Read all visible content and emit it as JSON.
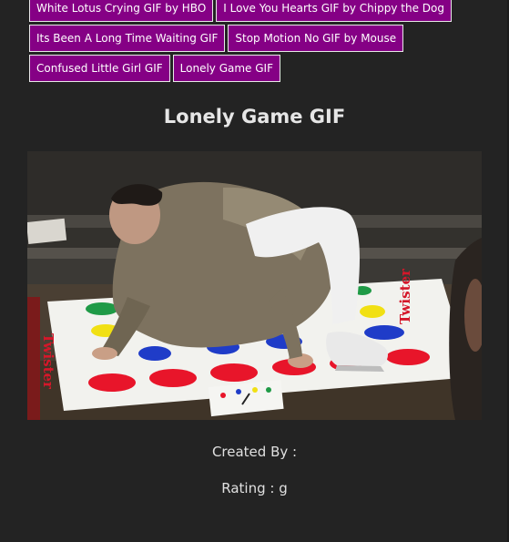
{
  "tags": {
    "rows": [
      [
        "White Lotus Crying GIF by HBO",
        "I Love You Hearts GIF by Chippy the Dog"
      ],
      [
        "Its Been A Long Time Waiting GIF",
        "Stop Motion No GIF by Mouse"
      ],
      [
        "Confused Little Girl GIF",
        "Lonely Game GIF"
      ]
    ]
  },
  "gif": {
    "title": "Lonely Game GIF",
    "mat_text_left": "Twister",
    "mat_text_right": "Twister"
  },
  "meta": {
    "created_by": "Created By :",
    "rating": "Rating : g"
  },
  "colors": {
    "background": "#232323",
    "tag_background": "#850085",
    "tag_border": "#e8e8e8"
  }
}
